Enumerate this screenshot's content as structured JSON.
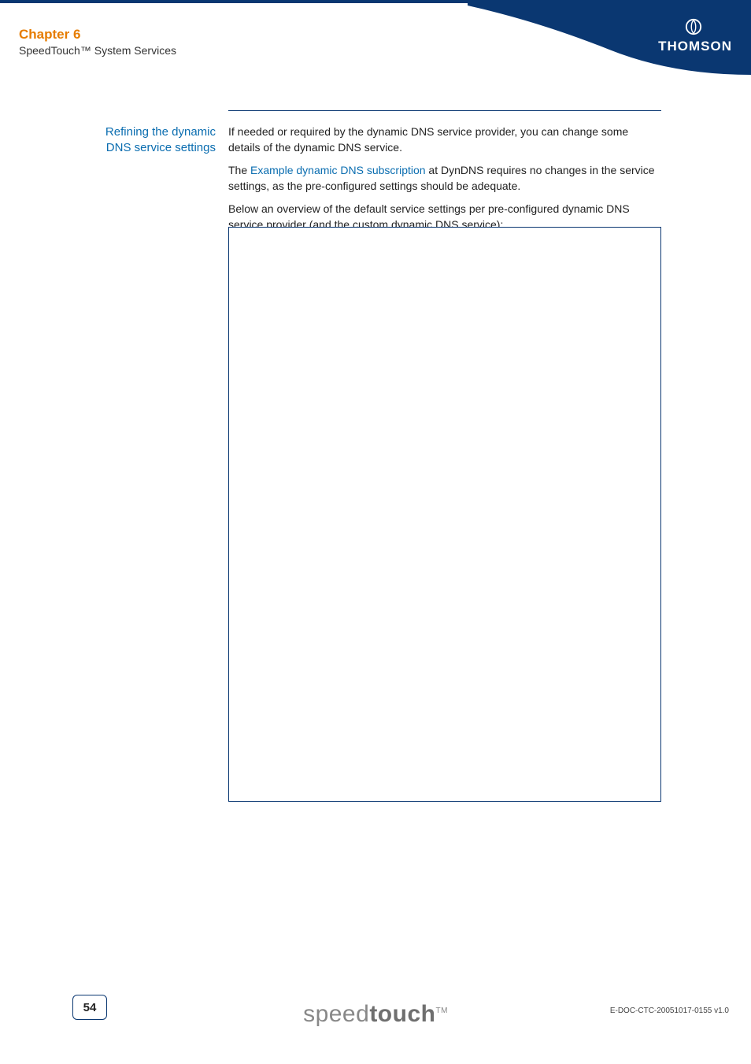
{
  "header": {
    "chapter": "Chapter 6",
    "subtitle": "SpeedTouch™ System Services",
    "brand": "THOMSON"
  },
  "section": {
    "side_heading": "Refining the dynamic DNS service settings",
    "para1": "If needed or required by the dynamic DNS service provider, you can change some details of the dynamic DNS service.",
    "para2_pre": "The ",
    "para2_link": "Example dynamic DNS subscription",
    "para2_post": " at DynDNS requires no changes in the service settings, as the pre-configured settings should be adequate.",
    "para3": "Below an overview of the default service settings per pre-configured dynamic DNS service provider (and the custom dynamic DNS service):"
  },
  "footer": {
    "page_number": "54",
    "brand_thin": "speed",
    "brand_bold": "touch",
    "brand_tm": "TM",
    "doc_id": "E-DOC-CTC-20051017-0155 v1.0"
  }
}
